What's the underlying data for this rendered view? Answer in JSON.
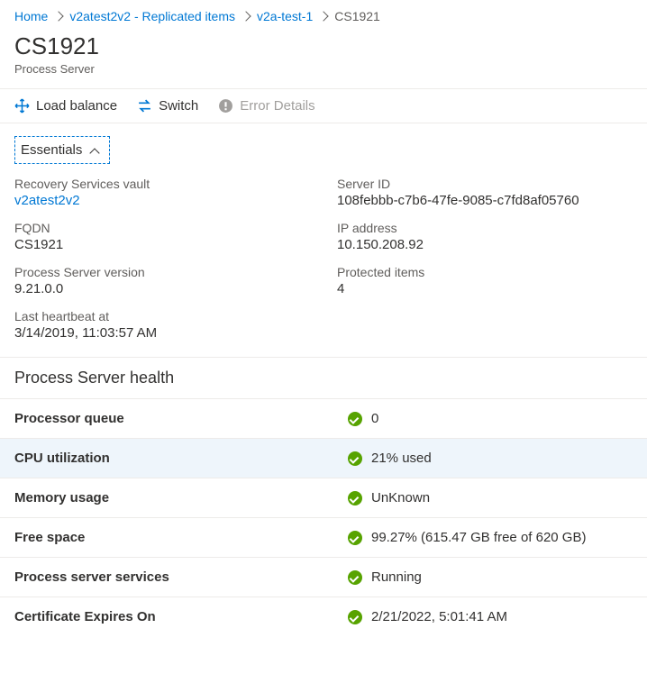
{
  "breadcrumb": {
    "items": [
      {
        "label": "Home"
      },
      {
        "label": "v2atest2v2 - Replicated items"
      },
      {
        "label": "v2a-test-1"
      }
    ],
    "current": "CS1921"
  },
  "header": {
    "title": "CS1921",
    "subtitle": "Process Server"
  },
  "toolbar": {
    "load_balance": "Load balance",
    "switch": "Switch",
    "error_details": "Error Details"
  },
  "essentials": {
    "toggle_label": "Essentials",
    "left": [
      {
        "label": "Recovery Services vault",
        "value": "v2atest2v2",
        "link": true
      },
      {
        "label": "FQDN",
        "value": "CS1921"
      },
      {
        "label": "Process Server version",
        "value": "9.21.0.0"
      },
      {
        "label": "Last heartbeat at",
        "value": "3/14/2019, 11:03:57 AM"
      }
    ],
    "right": [
      {
        "label": "Server ID",
        "value": "108febbb-c7b6-47fe-9085-c7fd8af05760"
      },
      {
        "label": "IP address",
        "value": "10.150.208.92"
      },
      {
        "label": "Protected items",
        "value": "4"
      }
    ]
  },
  "health": {
    "title": "Process Server health",
    "rows": [
      {
        "label": "Processor queue",
        "value": "0",
        "status": "ok"
      },
      {
        "label": "CPU utilization",
        "value": "21% used",
        "status": "ok",
        "highlight": true
      },
      {
        "label": "Memory usage",
        "value": "UnKnown",
        "status": "ok"
      },
      {
        "label": "Free space",
        "value": "99.27% (615.47 GB free of 620 GB)",
        "status": "ok"
      },
      {
        "label": "Process server services",
        "value": "Running",
        "status": "ok"
      },
      {
        "label": "Certificate Expires On",
        "value": "2/21/2022, 5:01:41 AM",
        "status": "ok"
      }
    ]
  }
}
